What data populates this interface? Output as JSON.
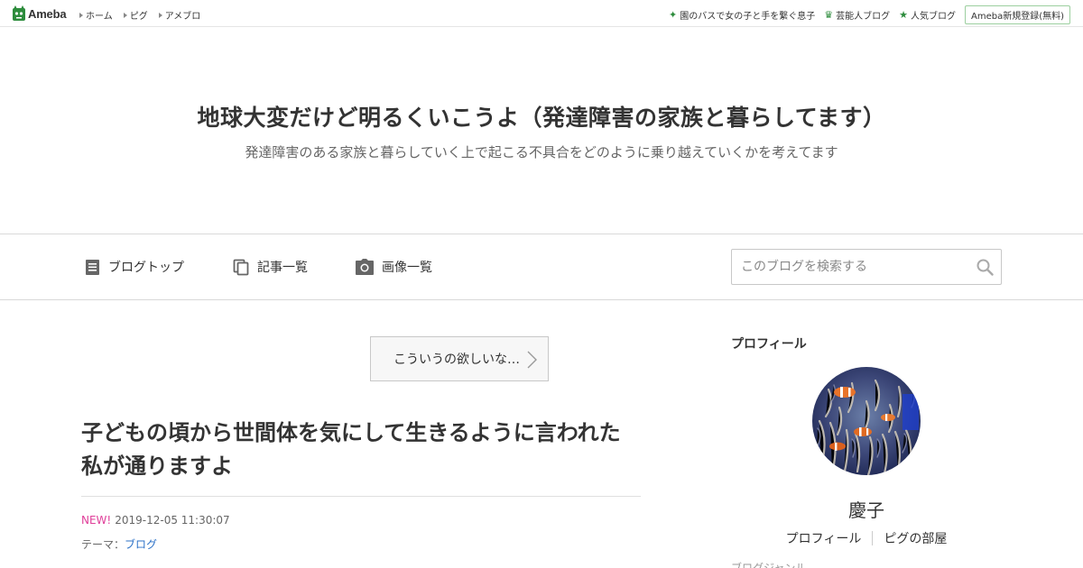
{
  "topbar": {
    "logo_text": "Ameba",
    "nav": [
      {
        "label": "ホーム"
      },
      {
        "label": "ピグ"
      },
      {
        "label": "アメブロ"
      }
    ],
    "right_links": [
      {
        "label": "園のバスで女の子と手を繋ぐ息子",
        "icon": "sparkle-icon"
      },
      {
        "label": "芸能人ブログ",
        "icon": "crown-icon"
      },
      {
        "label": "人気ブログ",
        "icon": "star-icon"
      }
    ],
    "register_label": "Ameba新規登録(無料)"
  },
  "header": {
    "title": "地球大変だけど明るくいこうよ（発達障害の家族と暮らしてます）",
    "description": "発達障害のある家族と暮らしていく上で起こる不具合をどのように乗り越えていくかを考えてます"
  },
  "nav": {
    "items": [
      {
        "label": "ブログトップ",
        "icon": "document-icon"
      },
      {
        "label": "記事一覧",
        "icon": "copy-icon"
      },
      {
        "label": "画像一覧",
        "icon": "camera-icon"
      }
    ],
    "search_placeholder": "このブログを検索する"
  },
  "main": {
    "prev_entry_label": "こういうの欲しいな…",
    "entry": {
      "title": "子どもの頃から世間体を気にして生きるように言われた私が通りますよ",
      "new_badge": "NEW!",
      "date": "2019-12-05 11:30:07",
      "theme_label": "テーマ：",
      "theme_value": "ブログ"
    }
  },
  "sidebar": {
    "heading": "プロフィール",
    "name": "慶子",
    "links": [
      {
        "label": "プロフィール"
      },
      {
        "label": "ピグの部屋"
      }
    ],
    "cut_text": "ブログジャンル"
  },
  "colors": {
    "brand_green": "#2d8c3c",
    "new_badge": "#e0409a",
    "link_blue": "#2c71c7",
    "border": "#d9d9d9"
  }
}
